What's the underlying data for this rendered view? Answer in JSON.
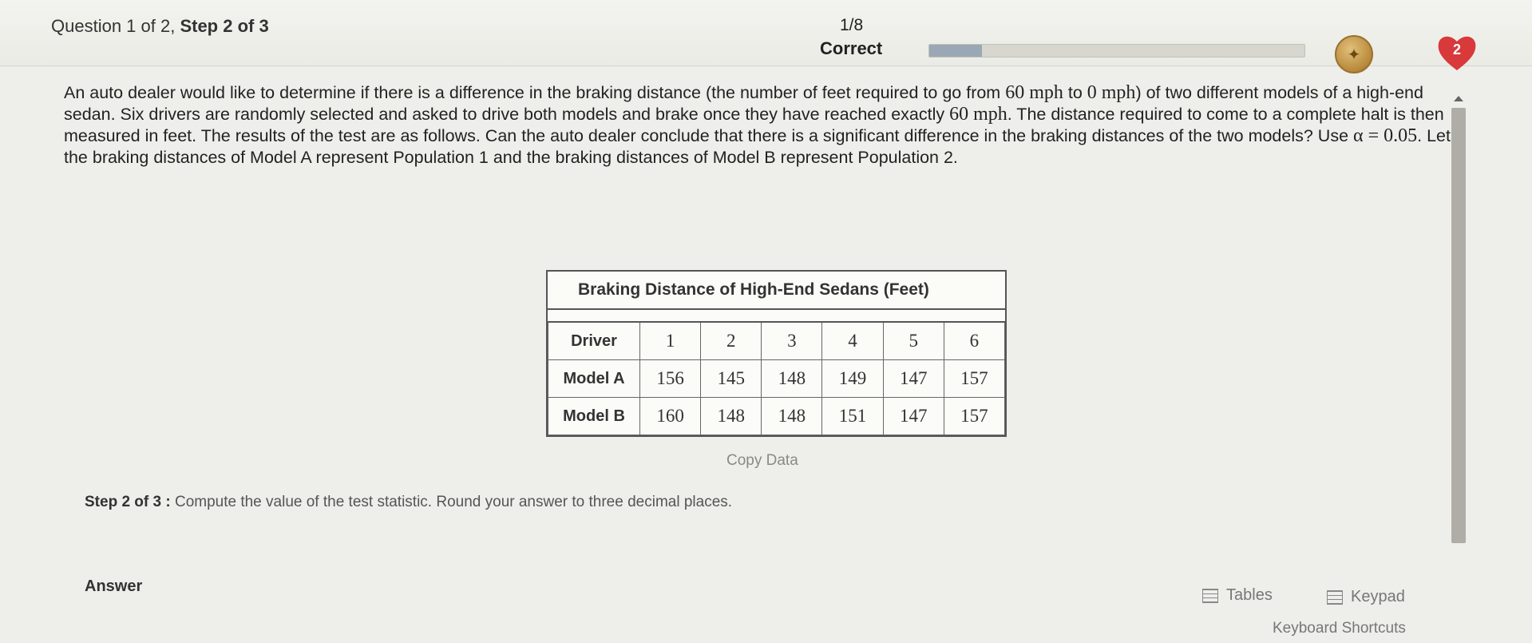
{
  "header": {
    "question_prefix": "Question 1 of 2, ",
    "question_step": "Step 2 of 3",
    "progress_count": "1/8",
    "progress_status": "Correct",
    "progress_fraction": 0.14,
    "badge_count": "2"
  },
  "question": {
    "p1": "An auto dealer would like to determine if there is a difference in the braking distance (the number of feet required to go from ",
    "m1": "60 mph",
    "p2": " to ",
    "m2": "0 mph",
    "p3": ") of two different models of a high-end sedan. Six drivers are randomly selected and asked to drive both models and brake once they have reached exactly ",
    "m3": "60 mph",
    "p4": ". The distance required to come to a complete halt is then measured in feet. The results of the test are as follows. Can the auto dealer conclude that there is a significant difference in the braking distances of the two models? Use ",
    "m4": "α = 0.05",
    "p5": ". Let the braking distances of Model A represent Population 1 and the braking distances of Model B represent Population 2."
  },
  "table": {
    "title": "Braking Distance of High-End Sedans (Feet)",
    "header_label": "Driver",
    "drivers": [
      "1",
      "2",
      "3",
      "4",
      "5",
      "6"
    ],
    "model_a_label": "Model A",
    "model_a": [
      "156",
      "145",
      "148",
      "149",
      "147",
      "157"
    ],
    "model_b_label": "Model B",
    "model_b": [
      "160",
      "148",
      "148",
      "151",
      "147",
      "157"
    ]
  },
  "copy_data_label": "Copy Data",
  "step": {
    "label": "Step 2 of 3 :",
    "text": " Compute the value of the test statistic. Round your answer to three decimal places."
  },
  "answer_label": "Answer",
  "tools": {
    "tables_label": "Tables",
    "keypad_label": "Keypad",
    "shortcuts_label": "Keyboard Shortcuts"
  },
  "colors": {
    "heart": "#d8393a",
    "badge": "#b8893a",
    "progress_fill": "#9aa7b4"
  }
}
